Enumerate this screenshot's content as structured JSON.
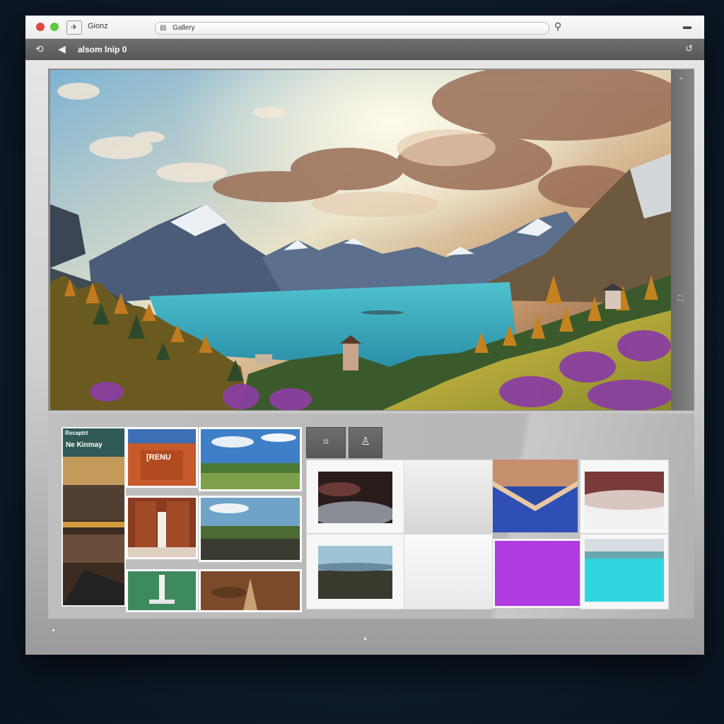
{
  "window": {
    "app_icon": "✈",
    "title": "Gionz",
    "address_icon": "page-icon",
    "address_text": "Gallery",
    "search_icon": "search-icon",
    "menu_icon": "menu-icon"
  },
  "toolbar": {
    "back_icon": "back-arrow-icon",
    "forward_icon": "forward-arrow-icon",
    "breadcrumb": "alsom lnip",
    "breadcrumb_marker": "0",
    "refresh_icon": "refresh-icon"
  },
  "hero": {
    "description_hidden": "",
    "scroll_up_icon": "chevron-up-icon",
    "side_icon": "expand-icon"
  },
  "gallery": {
    "header_small": "Rscaptrt",
    "header_title": "Ne Kinmay",
    "thumb_label_red": "[RENU",
    "tools": [
      {
        "icon": "crop-tool-icon",
        "glyph": "⌗"
      },
      {
        "icon": "person-icon",
        "glyph": "♙"
      }
    ],
    "card_captions": [
      "",
      "",
      "",
      "",
      "",
      "",
      "",
      "",
      "",
      ""
    ]
  }
}
